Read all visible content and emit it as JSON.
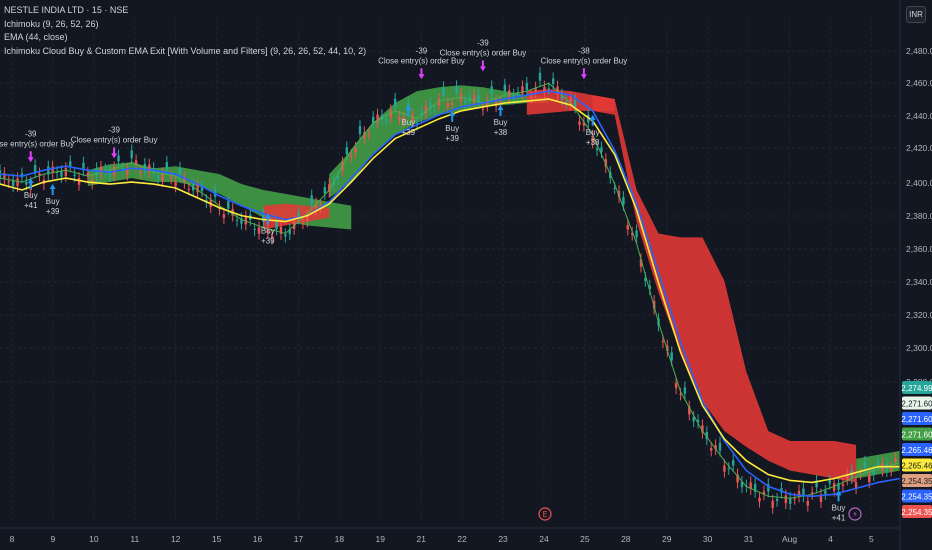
{
  "header": {
    "symbol": "NESTLE INDIA LTD · 15 · NSE",
    "indicator_1": "Ichimoku (9, 26, 52, 26)",
    "indicator_2": "EMA (44, close)",
    "indicator_3": "Ichimoku Cloud Buy & Custom EMA Exit [With Volume and Filters] (9, 26, 26, 52, 44, 10, 2)",
    "currency": "INR"
  },
  "chart_data": {
    "type": "line",
    "x_ticks": [
      "8",
      "9",
      "10",
      "11",
      "12",
      "15",
      "16",
      "17",
      "18",
      "19",
      "21",
      "22",
      "23",
      "24",
      "25",
      "28",
      "29",
      "30",
      "31",
      "Aug",
      "4",
      "5"
    ],
    "y_ticks": [
      "2,480.00",
      "2,460.00",
      "2,440.00",
      "2,420.00",
      "2,400.00",
      "2,380.00",
      "2,360.00",
      "2,340.00",
      "2,320.00",
      "2,300.00",
      "2,280.00"
    ],
    "ylim": [
      2245,
      2498
    ],
    "x_positions": [
      0,
      5,
      10,
      15,
      20,
      25,
      30,
      35,
      40,
      45,
      50,
      55,
      60,
      65,
      70,
      75,
      80,
      85,
      90,
      95,
      100,
      105,
      110,
      115,
      120,
      125,
      130,
      135,
      140,
      145,
      150,
      155,
      160,
      165,
      170,
      175,
      180,
      185,
      190,
      195,
      200,
      205
    ],
    "series": [
      {
        "values": [
          2418,
          2416,
          2420,
          2422,
          2419,
          2422,
          2426,
          2421,
          2419,
          2412,
          2404,
          2397,
          2393,
          2390,
          2400,
          2412,
          2432,
          2446,
          2452,
          2448,
          2457,
          2459,
          2456,
          2460,
          2462,
          2466,
          2456,
          2440,
          2415,
          2385,
          2345,
          2310,
          2290,
          2275,
          2262,
          2257,
          2256,
          2258,
          2262,
          2267,
          2271,
          2274
        ]
      },
      {
        "values": [
          2420,
          2419,
          2422,
          2424,
          2422,
          2421,
          2423,
          2422,
          2420,
          2415,
          2409,
          2404,
          2400,
          2397,
          2399,
          2406,
          2418,
          2430,
          2440,
          2445,
          2450,
          2454,
          2456,
          2458,
          2460,
          2462,
          2460,
          2452,
          2432,
          2405,
          2370,
          2335,
          2305,
          2285,
          2270,
          2262,
          2258,
          2257,
          2258,
          2261,
          2264,
          2266
        ]
      },
      {
        "values": [
          2415,
          2412,
          2416,
          2418,
          2416,
          2415,
          2416,
          2415,
          2413,
          2408,
          2403,
          2399,
          2397,
          2396,
          2399,
          2405,
          2416,
          2428,
          2438,
          2443,
          2448,
          2452,
          2454,
          2456,
          2457,
          2458,
          2455,
          2447,
          2430,
          2402,
          2365,
          2330,
          2303,
          2286,
          2275,
          2268,
          2265,
          2264,
          2266,
          2269,
          2272,
          2272
        ]
      }
    ],
    "cloud": [
      {
        "start": 4,
        "end": 16,
        "color": "green",
        "upper": [
          2422,
          2425,
          2426,
          2423,
          2424,
          2422,
          2420,
          2415,
          2412,
          2410,
          2408,
          2406,
          2404
        ],
        "lower": [
          2414,
          2416,
          2418,
          2416,
          2416,
          2414,
          2410,
          2404,
          2398,
          2396,
          2394,
          2393,
          2392
        ]
      },
      {
        "start": 12,
        "end": 15,
        "color": "red",
        "upper": [
          2404,
          2405,
          2404,
          2403
        ],
        "lower": [
          2392,
          2394,
          2396,
          2398
        ]
      },
      {
        "start": 15,
        "end": 25,
        "color": "green",
        "upper": [
          2420,
          2432,
          2446,
          2456,
          2462,
          2464,
          2465,
          2464,
          2462,
          2460,
          2459
        ],
        "lower": [
          2408,
          2416,
          2430,
          2440,
          2446,
          2450,
          2452,
          2454,
          2455,
          2456,
          2456
        ]
      },
      {
        "start": 24,
        "end": 28,
        "color": "red",
        "upper": [
          2462,
          2463,
          2462,
          2460,
          2458
        ],
        "lower": [
          2450,
          2451,
          2452,
          2452,
          2452
        ]
      },
      {
        "start": 27,
        "end": 39,
        "color": "red",
        "upper": [
          2460,
          2458,
          2412,
          2390,
          2388,
          2388,
          2366,
          2320,
          2290,
          2285,
          2285,
          2285,
          2283
        ],
        "lower": [
          2452,
          2450,
          2396,
          2360,
          2330,
          2305,
          2290,
          2282,
          2275,
          2270,
          2268,
          2266,
          2264
        ]
      },
      {
        "start": 39,
        "end": 41,
        "color": "green",
        "upper": [
          2276,
          2278,
          2280
        ],
        "lower": [
          2266,
          2268,
          2270
        ]
      }
    ],
    "labels": {
      "close_entry": "Close entry(s) order Buy",
      "buy": "Buy",
      "amounts": [
        "-39",
        "-38",
        "+39",
        "+38",
        "+41"
      ]
    },
    "price_tags": [
      "2,274.99",
      "2,271.60",
      "2,271.60",
      "2,271.60",
      "2,265.46",
      "2,265.46",
      "2,254.35",
      "2,254.35",
      "2,254.35"
    ],
    "colors": {
      "background": "#131722",
      "grid": "#1f2430",
      "up": "#26a69a",
      "down": "#ef5350",
      "cloud_green": "#43a047",
      "cloud_red": "#e53935",
      "ema": "#ffeb3b",
      "ichimoku_blue": "#2962ff",
      "lagging": "#4caf50",
      "buy_marker": "#2196f3",
      "close_marker": "#e040fb"
    },
    "events": [
      "E",
      "⚡"
    ],
    "grid": true,
    "legend": "top-left"
  }
}
